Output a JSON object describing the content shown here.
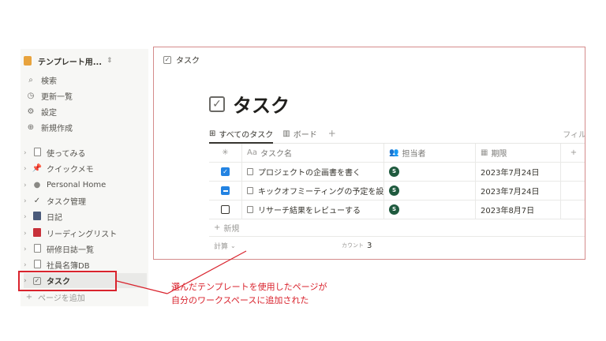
{
  "sidebar": {
    "workspace_name": "テンプレート用...",
    "workspace_chevron": "⌃⌄",
    "nav": [
      {
        "label": "検索",
        "icon": "search-icon",
        "glyph": "🔍"
      },
      {
        "label": "更新一覧",
        "icon": "clock-icon",
        "glyph": "◷"
      },
      {
        "label": "設定",
        "icon": "gear-icon",
        "glyph": "⚙"
      },
      {
        "label": "新規作成",
        "icon": "plus-circle-icon",
        "glyph": "⊕"
      }
    ],
    "pages": [
      {
        "label": "使ってみる"
      },
      {
        "label": "クイックメモ"
      },
      {
        "label": "Personal Home"
      },
      {
        "label": "タスク管理"
      },
      {
        "label": "日記"
      },
      {
        "label": "リーディングリスト"
      },
      {
        "label": "研修日誌一覧"
      },
      {
        "label": "社員名簿DB"
      },
      {
        "label": "タスク"
      }
    ],
    "add_page": "ページを追加"
  },
  "main": {
    "breadcrumb": "タスク",
    "title": "タスク",
    "views": [
      {
        "label": "すべてのタスク"
      },
      {
        "label": "ボード"
      }
    ],
    "view_add": "+",
    "filter_label": "フィル",
    "table": {
      "headers": {
        "name": "タスク名",
        "name_prefix": "Aa",
        "owner": "担当者",
        "due": "期限",
        "add": "+"
      },
      "rows": [
        {
          "status": "checked",
          "name": "プロジェクトの企画書を書く",
          "owner_initial": "S",
          "due": "2023年7月24日"
        },
        {
          "status": "mixed",
          "name": "キックオフミーティングの予定を設",
          "owner_initial": "S",
          "due": "2023年7月24日"
        },
        {
          "status": "unchecked",
          "name": "リサーチ結果をレビューする",
          "owner_initial": "S",
          "due": "2023年8月7日"
        }
      ],
      "new_label": "新規",
      "calc_label": "計算",
      "count_label": "カウント",
      "count_value": "3"
    }
  },
  "annotation": {
    "line1": "選んだテンプレートを使用したページが",
    "line2": "自分のワークスペースに追加された",
    "color": "#d9232d"
  }
}
